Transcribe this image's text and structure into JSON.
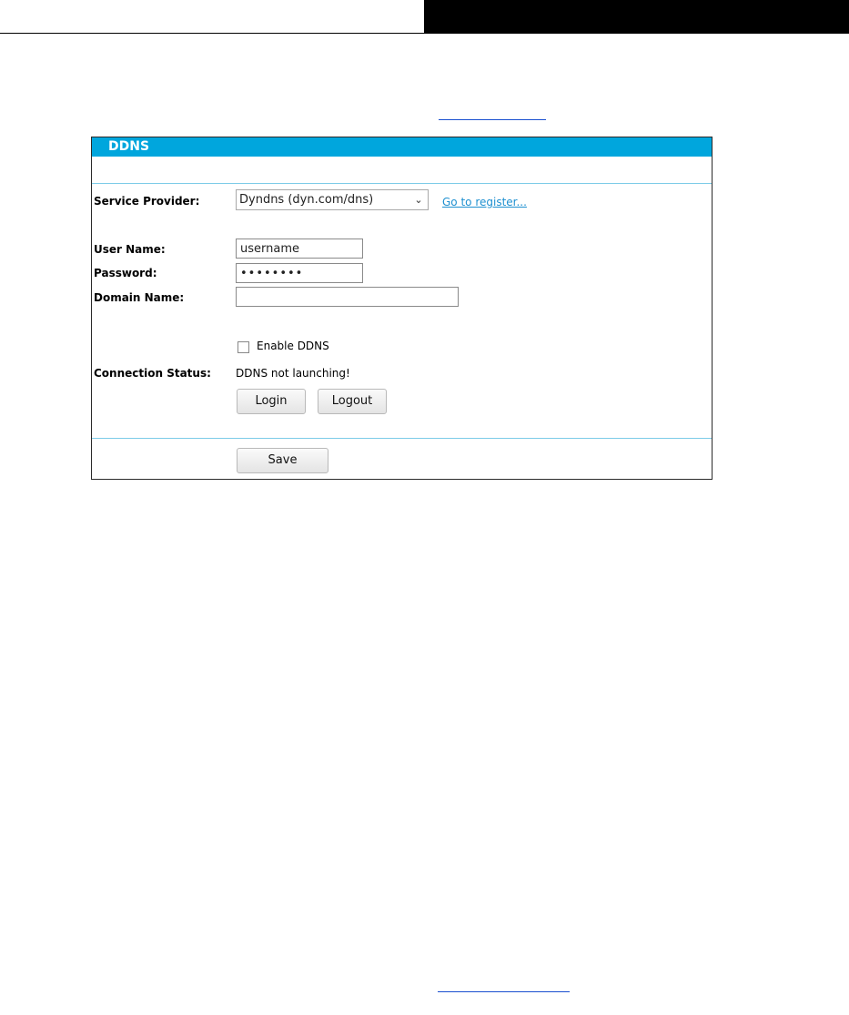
{
  "panel": {
    "title": "DDNS"
  },
  "form": {
    "service_provider_label": "Service Provider:",
    "service_provider_value": "Dyndns (dyn.com/dns)",
    "register_link": "Go to register...",
    "user_name_label": "User Name:",
    "user_name_value": "username",
    "password_label": "Password:",
    "password_value": "••••••••",
    "domain_name_label": "Domain Name:",
    "domain_name_value": "",
    "enable_ddns_label": "Enable DDNS",
    "enable_ddns_checked": false,
    "connection_status_label": "Connection Status:",
    "connection_status_value": "DDNS not launching!"
  },
  "buttons": {
    "login": "Login",
    "logout": "Logout",
    "save": "Save"
  },
  "icons": {
    "dropdown": "chevron-down-icon"
  },
  "colors": {
    "title_bar": "#00a6dd",
    "separator": "#7ccbe8",
    "link": "#1e90d0"
  }
}
